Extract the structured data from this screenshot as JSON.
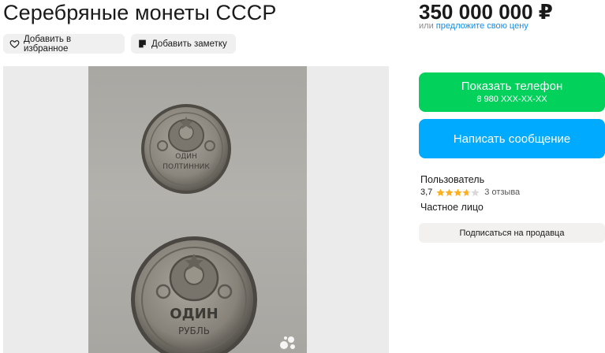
{
  "listing": {
    "title": "Серебряные монеты СССР",
    "actions": {
      "favorite_label": "Добавить в избранное",
      "note_label": "Добавить заметку"
    }
  },
  "gallery": {
    "watermark": "Avito",
    "coin_top_text": "ОДИН ПОЛТИННИК",
    "coin_bottom_text": "ОДИН РУБЛЬ"
  },
  "price": {
    "value": "350 000 000 ₽",
    "or_text": "или ",
    "offer_link": "предложите свою цену"
  },
  "contact": {
    "phone_button": "Показать телефон",
    "phone_masked": "8 980 XXX-XX-XX",
    "message_button": "Написать сообщение"
  },
  "seller": {
    "name": "Пользователь",
    "rating": "3,7",
    "stars": 3.7,
    "reviews": "3 отзыва",
    "type": "Частное лицо",
    "subscribe_button": "Подписаться на продавца"
  },
  "colors": {
    "phone_button": "#02d15c",
    "message_button": "#00aaff",
    "link": "#0a8ff0",
    "star": "#ffb021"
  },
  "icons": {
    "favorite": "heart-icon",
    "note": "note-icon",
    "star": "star-icon"
  }
}
